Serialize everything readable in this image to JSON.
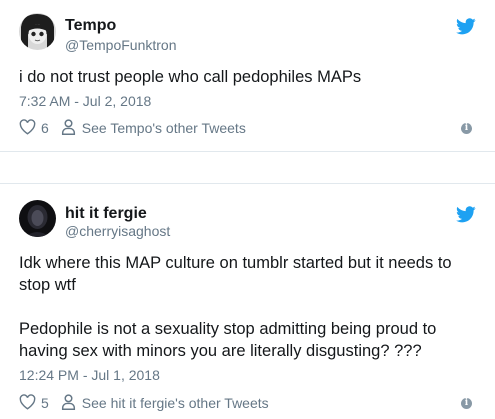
{
  "tweets": [
    {
      "name": "Tempo",
      "handle": "@TempoFunktron",
      "text": "i do not trust people who call pedophiles MAPs",
      "timestamp": "7:32 AM - Jul 2, 2018",
      "likes": "6",
      "other_tweets_label": "See Tempo's other Tweets"
    },
    {
      "name": "hit it fergie",
      "handle": "@cherryisaghost",
      "text": "Idk where this MAP culture on tumblr started but it needs to stop wtf\n\nPedophile is not a sexuality stop admitting being proud to having sex with minors you are literally disgusting? ???",
      "timestamp": "12:24 PM - Jul 1, 2018",
      "likes": "5",
      "other_tweets_label": "See hit it fergie's other Tweets"
    }
  ],
  "icons": {
    "brand": "twitter-bird-icon",
    "like": "heart-icon",
    "profile": "person-icon",
    "info": "info-icon"
  },
  "colors": {
    "twitter_blue": "#1da1f2",
    "secondary_text": "#657786",
    "primary_text": "#14171a",
    "divider": "#e1e8ed"
  }
}
